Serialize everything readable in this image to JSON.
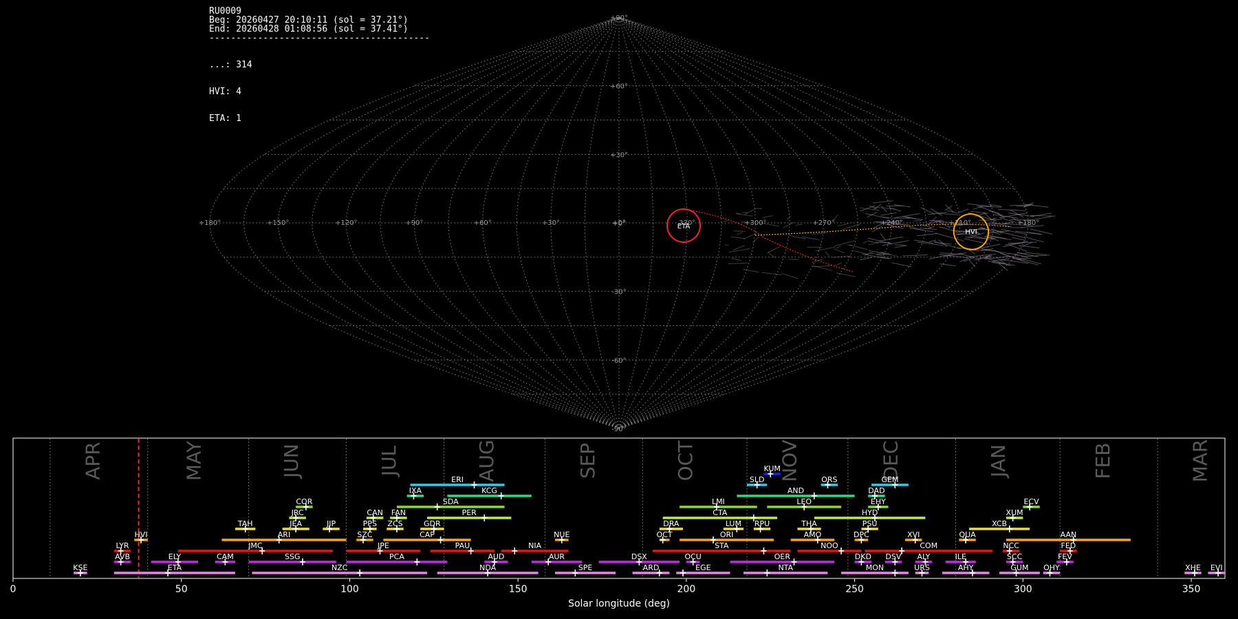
{
  "header": {
    "station": "RU0009",
    "beg": "Beg: 20260427 20:10:11 (sol = 37.21°)",
    "end": "End: 20260428 01:08:56 (sol = 37.41°)",
    "rule": "-----------------------------------------",
    "counts": [
      {
        "code": "...",
        "n": 314
      },
      {
        "code": "HVI",
        "n": 4
      },
      {
        "code": "ETA",
        "n": 1
      }
    ]
  },
  "skymap": {
    "ra_labels": [
      "+180°",
      "+150°",
      "+120°",
      "+90°",
      "+60°",
      "+30°",
      "+0°",
      "330°",
      "+300°",
      "+270°",
      "+240°",
      "+210°",
      "+180°"
    ],
    "dec_labels": [
      "+90°",
      "+60°",
      "+30°",
      "+0°",
      "-30°",
      "-60°",
      "-90°"
    ],
    "circled_showers": [
      {
        "code": "ETA",
        "color": "#ff2020"
      },
      {
        "code": "HVI",
        "color": "#ffa500"
      }
    ]
  },
  "chart_data": {
    "type": "timeline",
    "xlabel": "Solar longitude (deg)",
    "xlim": [
      0,
      360
    ],
    "xticks": [
      0,
      50,
      100,
      150,
      200,
      250,
      300,
      350
    ],
    "current_sol": 37.3,
    "months": [
      {
        "name": "APR",
        "at": 24
      },
      {
        "name": "MAY",
        "at": 54
      },
      {
        "name": "JUN",
        "at": 83
      },
      {
        "name": "JUL",
        "at": 112
      },
      {
        "name": "AUG",
        "at": 141
      },
      {
        "name": "SEP",
        "at": 171
      },
      {
        "name": "OCT",
        "at": 200
      },
      {
        "name": "NOV",
        "at": 231
      },
      {
        "name": "DEC",
        "at": 261
      },
      {
        "name": "JAN",
        "at": 293
      },
      {
        "name": "FEB",
        "at": 324
      },
      {
        "name": "MAR",
        "at": 353
      }
    ],
    "month_boundaries": [
      11,
      40,
      70,
      99,
      128,
      158,
      187,
      218,
      248,
      280,
      311,
      340
    ],
    "showers": [
      {
        "code": "KUM",
        "start": 223,
        "end": 228,
        "peak": 225,
        "row": 10,
        "color": "#1a1aff"
      },
      {
        "code": "ERI",
        "start": 118,
        "end": 146,
        "peak": 137,
        "row": 9,
        "color": "#22d0f0"
      },
      {
        "code": "SLD",
        "start": 218,
        "end": 224,
        "peak": 221,
        "row": 9,
        "color": "#22d0f0"
      },
      {
        "code": "ORS",
        "start": 240,
        "end": 245,
        "peak": 242,
        "row": 9,
        "color": "#22d0f0"
      },
      {
        "code": "GEM",
        "start": 255,
        "end": 266,
        "peak": 262,
        "row": 9,
        "color": "#22d0f0"
      },
      {
        "code": "IXA",
        "start": 117,
        "end": 122,
        "peak": 119,
        "row": 8,
        "color": "#22e07a"
      },
      {
        "code": "KCG",
        "start": 129,
        "end": 154,
        "peak": 145,
        "row": 8,
        "color": "#22e07a"
      },
      {
        "code": "AND",
        "start": 215,
        "end": 250,
        "peak": 238,
        "row": 8,
        "color": "#22e07a"
      },
      {
        "code": "DAD",
        "start": 254,
        "end": 259,
        "peak": 256,
        "row": 8,
        "color": "#22e07a"
      },
      {
        "code": "COR",
        "start": 84,
        "end": 89,
        "peak": 87,
        "row": 7,
        "color": "#88dd22"
      },
      {
        "code": "SDA",
        "start": 114,
        "end": 146,
        "peak": 126,
        "row": 7,
        "color": "#88dd22"
      },
      {
        "code": "LMI",
        "start": 198,
        "end": 221,
        "peak": 209,
        "row": 7,
        "color": "#88dd22"
      },
      {
        "code": "LEO",
        "start": 224,
        "end": 246,
        "peak": 235,
        "row": 7,
        "color": "#88dd22"
      },
      {
        "code": "EHY",
        "start": 254,
        "end": 260,
        "peak": 257,
        "row": 7,
        "color": "#88dd22"
      },
      {
        "code": "ECV",
        "start": 300,
        "end": 305,
        "peak": 302,
        "row": 7,
        "color": "#88dd22"
      },
      {
        "code": "JRC",
        "start": 82,
        "end": 87,
        "peak": 84,
        "row": 6,
        "color": "#b8f030"
      },
      {
        "code": "CAN",
        "start": 105,
        "end": 110,
        "peak": 107,
        "row": 6,
        "color": "#b8f030"
      },
      {
        "code": "FAN",
        "start": 112,
        "end": 117,
        "peak": 114,
        "row": 6,
        "color": "#b8f030"
      },
      {
        "code": "PER",
        "start": 123,
        "end": 148,
        "peak": 140,
        "row": 6,
        "color": "#b8f030"
      },
      {
        "code": "CTA",
        "start": 193,
        "end": 227,
        "peak": 220,
        "row": 6,
        "color": "#b8f030"
      },
      {
        "code": "HYD",
        "start": 238,
        "end": 271,
        "peak": 256,
        "row": 6,
        "color": "#b8f030"
      },
      {
        "code": "XUM",
        "start": 295,
        "end": 300,
        "peak": 297,
        "row": 6,
        "color": "#b8f030"
      },
      {
        "code": "TAH",
        "start": 66,
        "end": 72,
        "peak": 69,
        "row": 5,
        "color": "#f0e020"
      },
      {
        "code": "JEA",
        "start": 80,
        "end": 88,
        "peak": 84,
        "row": 5,
        "color": "#f0e020"
      },
      {
        "code": "JIP",
        "start": 92,
        "end": 97,
        "peak": 94,
        "row": 5,
        "color": "#f0e020"
      },
      {
        "code": "PPS",
        "start": 104,
        "end": 108,
        "peak": 106,
        "row": 5,
        "color": "#f0e020"
      },
      {
        "code": "ZCS",
        "start": 111,
        "end": 116,
        "peak": 114,
        "row": 5,
        "color": "#f0e020"
      },
      {
        "code": "GDR",
        "start": 121,
        "end": 128,
        "peak": 125,
        "row": 5,
        "color": "#f0e020"
      },
      {
        "code": "DRA",
        "start": 192,
        "end": 199,
        "peak": 195,
        "row": 5,
        "color": "#f0e020"
      },
      {
        "code": "LUM",
        "start": 211,
        "end": 217,
        "peak": 215,
        "row": 5,
        "color": "#f0e020"
      },
      {
        "code": "RPU",
        "start": 220,
        "end": 225,
        "peak": 222,
        "row": 5,
        "color": "#f0e020"
      },
      {
        "code": "THA",
        "start": 233,
        "end": 240,
        "peak": 237,
        "row": 5,
        "color": "#f0e020"
      },
      {
        "code": "PSU",
        "start": 252,
        "end": 257,
        "peak": 254,
        "row": 5,
        "color": "#f0e020"
      },
      {
        "code": "XCB",
        "start": 284,
        "end": 302,
        "peak": 296,
        "row": 5,
        "color": "#f0e020"
      },
      {
        "code": "HVI",
        "start": 36,
        "end": 40,
        "peak": 38,
        "row": 4,
        "color": "#ffa500"
      },
      {
        "code": "ARI",
        "start": 62,
        "end": 99,
        "peak": 79,
        "row": 4,
        "color": "#ffa500"
      },
      {
        "code": "SZC",
        "start": 102,
        "end": 107,
        "peak": 104,
        "row": 4,
        "color": "#ffa500"
      },
      {
        "code": "CAP",
        "start": 110,
        "end": 136,
        "peak": 127,
        "row": 4,
        "color": "#ffa500"
      },
      {
        "code": "NUE",
        "start": 161,
        "end": 165,
        "peak": 163,
        "row": 4,
        "color": "#ffa500"
      },
      {
        "code": "OCT",
        "start": 192,
        "end": 195,
        "peak": 193,
        "row": 4,
        "color": "#ffa500"
      },
      {
        "code": "ORI",
        "start": 198,
        "end": 226,
        "peak": 208,
        "row": 4,
        "color": "#ffa500"
      },
      {
        "code": "AMO",
        "start": 231,
        "end": 244,
        "peak": 239,
        "row": 4,
        "color": "#ffa500"
      },
      {
        "code": "DPC",
        "start": 250,
        "end": 254,
        "peak": 252,
        "row": 4,
        "color": "#ffa500"
      },
      {
        "code": "XVI",
        "start": 265,
        "end": 270,
        "peak": 268,
        "row": 4,
        "color": "#ffa500"
      },
      {
        "code": "QUA",
        "start": 281,
        "end": 286,
        "peak": 283,
        "row": 4,
        "color": "#ffa500"
      },
      {
        "code": "AAN",
        "start": 295,
        "end": 332,
        "peak": 315,
        "row": 4,
        "color": "#ffa500"
      },
      {
        "code": "LYR",
        "start": 30,
        "end": 35,
        "peak": 32,
        "row": 3,
        "color": "#ee1111"
      },
      {
        "code": "JMC",
        "start": 49,
        "end": 95,
        "peak": 74,
        "row": 3,
        "color": "#ee1111"
      },
      {
        "code": "JPE",
        "start": 99,
        "end": 121,
        "peak": 109,
        "row": 3,
        "color": "#ee1111"
      },
      {
        "code": "PAU",
        "start": 124,
        "end": 143,
        "peak": 136,
        "row": 3,
        "color": "#ee1111"
      },
      {
        "code": "NIA",
        "start": 145,
        "end": 165,
        "peak": 149,
        "row": 3,
        "color": "#ee1111"
      },
      {
        "code": "STA",
        "start": 190,
        "end": 231,
        "peak": 223,
        "row": 3,
        "color": "#ee1111"
      },
      {
        "code": "NOO",
        "start": 233,
        "end": 252,
        "peak": 246,
        "row": 3,
        "color": "#ee1111"
      },
      {
        "code": "COM",
        "start": 253,
        "end": 291,
        "peak": 264,
        "row": 3,
        "color": "#ee1111"
      },
      {
        "code": "NCC",
        "start": 294,
        "end": 299,
        "peak": 296,
        "row": 3,
        "color": "#ee1111"
      },
      {
        "code": "FED",
        "start": 311,
        "end": 316,
        "peak": 314,
        "row": 3,
        "color": "#ee1111"
      },
      {
        "code": "AVB",
        "start": 30,
        "end": 35,
        "peak": 32,
        "row": 2,
        "color": "#cc22ee"
      },
      {
        "code": "ELY",
        "start": 41,
        "end": 55,
        "peak": 49,
        "row": 2,
        "color": "#cc22ee"
      },
      {
        "code": "CAM",
        "start": 60,
        "end": 66,
        "peak": 63,
        "row": 2,
        "color": "#cc22ee"
      },
      {
        "code": "SSG",
        "start": 70,
        "end": 96,
        "peak": 86,
        "row": 2,
        "color": "#cc22ee"
      },
      {
        "code": "PCA",
        "start": 99,
        "end": 129,
        "peak": 120,
        "row": 2,
        "color": "#cc22ee"
      },
      {
        "code": "AUD",
        "start": 140,
        "end": 147,
        "peak": 143,
        "row": 2,
        "color": "#cc22ee"
      },
      {
        "code": "AUR",
        "start": 154,
        "end": 169,
        "peak": 159,
        "row": 2,
        "color": "#cc22ee"
      },
      {
        "code": "DSX",
        "start": 174,
        "end": 198,
        "peak": 186,
        "row": 2,
        "color": "#cc22ee"
      },
      {
        "code": "OCU",
        "start": 200,
        "end": 204,
        "peak": 202,
        "row": 2,
        "color": "#cc22ee"
      },
      {
        "code": "OER",
        "start": 213,
        "end": 244,
        "peak": 232,
        "row": 2,
        "color": "#cc22ee"
      },
      {
        "code": "DKD",
        "start": 250,
        "end": 255,
        "peak": 252,
        "row": 2,
        "color": "#cc22ee"
      },
      {
        "code": "DSV",
        "start": 259,
        "end": 264,
        "peak": 262,
        "row": 2,
        "color": "#cc22ee"
      },
      {
        "code": "ALY",
        "start": 268,
        "end": 273,
        "peak": 271,
        "row": 2,
        "color": "#cc22ee"
      },
      {
        "code": "ILE",
        "start": 277,
        "end": 286,
        "peak": 283,
        "row": 2,
        "color": "#cc22ee"
      },
      {
        "code": "SCC",
        "start": 295,
        "end": 300,
        "peak": 297,
        "row": 2,
        "color": "#cc22ee"
      },
      {
        "code": "FEV",
        "start": 310,
        "end": 315,
        "peak": 313,
        "row": 2,
        "color": "#cc22ee"
      },
      {
        "code": "KSE",
        "start": 18,
        "end": 22,
        "peak": 20,
        "row": 1,
        "color": "#ee80ee"
      },
      {
        "code": "ETA",
        "start": 30,
        "end": 66,
        "peak": 46,
        "row": 1,
        "color": "#ee80ee"
      },
      {
        "code": "NZC",
        "start": 71,
        "end": 123,
        "peak": 103,
        "row": 1,
        "color": "#ee80ee"
      },
      {
        "code": "NDA",
        "start": 126,
        "end": 156,
        "peak": 141,
        "row": 1,
        "color": "#ee80ee"
      },
      {
        "code": "SPE",
        "start": 161,
        "end": 179,
        "peak": 167,
        "row": 1,
        "color": "#ee80ee"
      },
      {
        "code": "ARD",
        "start": 184,
        "end": 195,
        "peak": 192,
        "row": 1,
        "color": "#ee80ee"
      },
      {
        "code": "EGE",
        "start": 197,
        "end": 213,
        "peak": 199,
        "row": 1,
        "color": "#ee80ee"
      },
      {
        "code": "NTA",
        "start": 217,
        "end": 242,
        "peak": 224,
        "row": 1,
        "color": "#ee80ee"
      },
      {
        "code": "MON",
        "start": 246,
        "end": 266,
        "peak": 262,
        "row": 1,
        "color": "#ee80ee"
      },
      {
        "code": "URS",
        "start": 268,
        "end": 272,
        "peak": 270,
        "row": 1,
        "color": "#ee80ee"
      },
      {
        "code": "AHY",
        "start": 276,
        "end": 290,
        "peak": 285,
        "row": 1,
        "color": "#ee80ee"
      },
      {
        "code": "GUM",
        "start": 293,
        "end": 305,
        "peak": 298,
        "row": 1,
        "color": "#ee80ee"
      },
      {
        "code": "OHY",
        "start": 306,
        "end": 311,
        "peak": 308,
        "row": 1,
        "color": "#ee80ee"
      },
      {
        "code": "XHE",
        "start": 348,
        "end": 353,
        "peak": 351,
        "row": 1,
        "color": "#ee80ee"
      },
      {
        "code": "EVI",
        "start": 355,
        "end": 360,
        "peak": 358,
        "row": 1,
        "color": "#ee80ee"
      }
    ]
  }
}
